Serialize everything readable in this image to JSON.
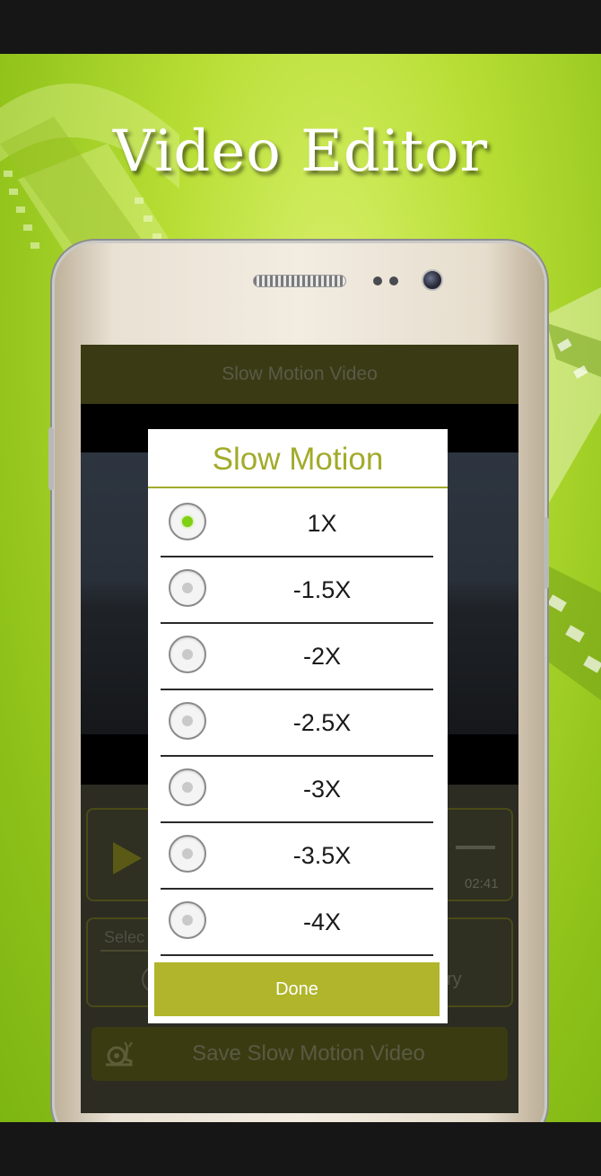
{
  "promo": {
    "title": "Video Editor"
  },
  "app": {
    "header_title": "Slow Motion Video",
    "player": {
      "time": "02:41"
    },
    "select_panel": {
      "label": "Selec",
      "partial_text": "ry"
    },
    "save_button": {
      "label": "Save Slow Motion Video"
    }
  },
  "dialog": {
    "title": "Slow Motion",
    "options": [
      {
        "label": "1X",
        "selected": true
      },
      {
        "label": "-1.5X",
        "selected": false
      },
      {
        "label": "-2X",
        "selected": false
      },
      {
        "label": "-2.5X",
        "selected": false
      },
      {
        "label": "-3X",
        "selected": false
      },
      {
        "label": "-3.5X",
        "selected": false
      },
      {
        "label": "-4X",
        "selected": false
      }
    ],
    "done_label": "Done"
  },
  "colors": {
    "accent": "#a2ab2a",
    "button": "#b0b52b",
    "selected_dot": "#7fcf12",
    "background_green": "#b8de35"
  },
  "icons": [
    "play-icon",
    "snail-icon",
    "radio-icon",
    "film-strip-icon"
  ]
}
